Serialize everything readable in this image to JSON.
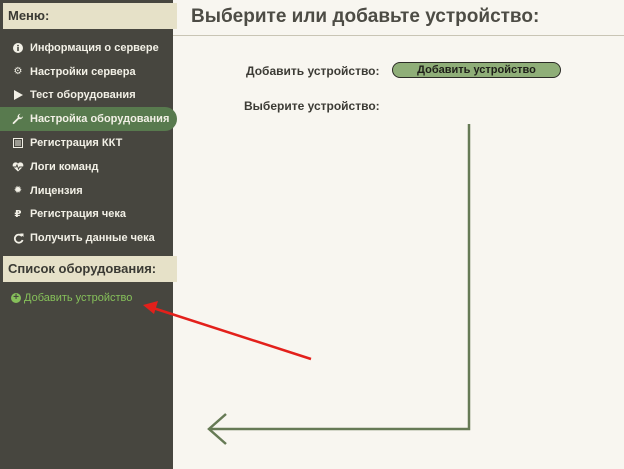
{
  "sidebar": {
    "menu_header": "Меню:",
    "menu_items": [
      {
        "label": "Информация о сервере",
        "icon": "info-icon"
      },
      {
        "label": "Настройки сервера",
        "icon": "gears-icon"
      },
      {
        "label": "Тест оборудования",
        "icon": "play-icon"
      },
      {
        "label": "Настройка оборудования",
        "icon": "wrench-icon",
        "active": true
      },
      {
        "label": "Регистрация ККТ",
        "icon": "list-icon"
      },
      {
        "label": "Логи команд",
        "icon": "heartbeat-icon"
      },
      {
        "label": "Лицензия",
        "icon": "certificate-icon"
      },
      {
        "label": "Регистрация чека",
        "icon": "ruble-icon"
      },
      {
        "label": "Получить данные чека",
        "icon": "refresh-icon"
      }
    ],
    "equipment_header": "Список оборудования:",
    "add_device_link": "Добавить устройство"
  },
  "main": {
    "title": "Выберите или добавьте устройство:",
    "add_device_label": "Добавить устройство:",
    "add_device_button": "Добавить устройство",
    "select_device_label": "Выберите устройство:"
  },
  "colors": {
    "sidebar_bg": "#47463f",
    "header_bg": "#e6e1c8",
    "active_item": "#587a4e",
    "link_green": "#86c05a",
    "button_green": "#8fae78",
    "red_arrow": "#e3201b",
    "green_arrow": "#667a55"
  }
}
